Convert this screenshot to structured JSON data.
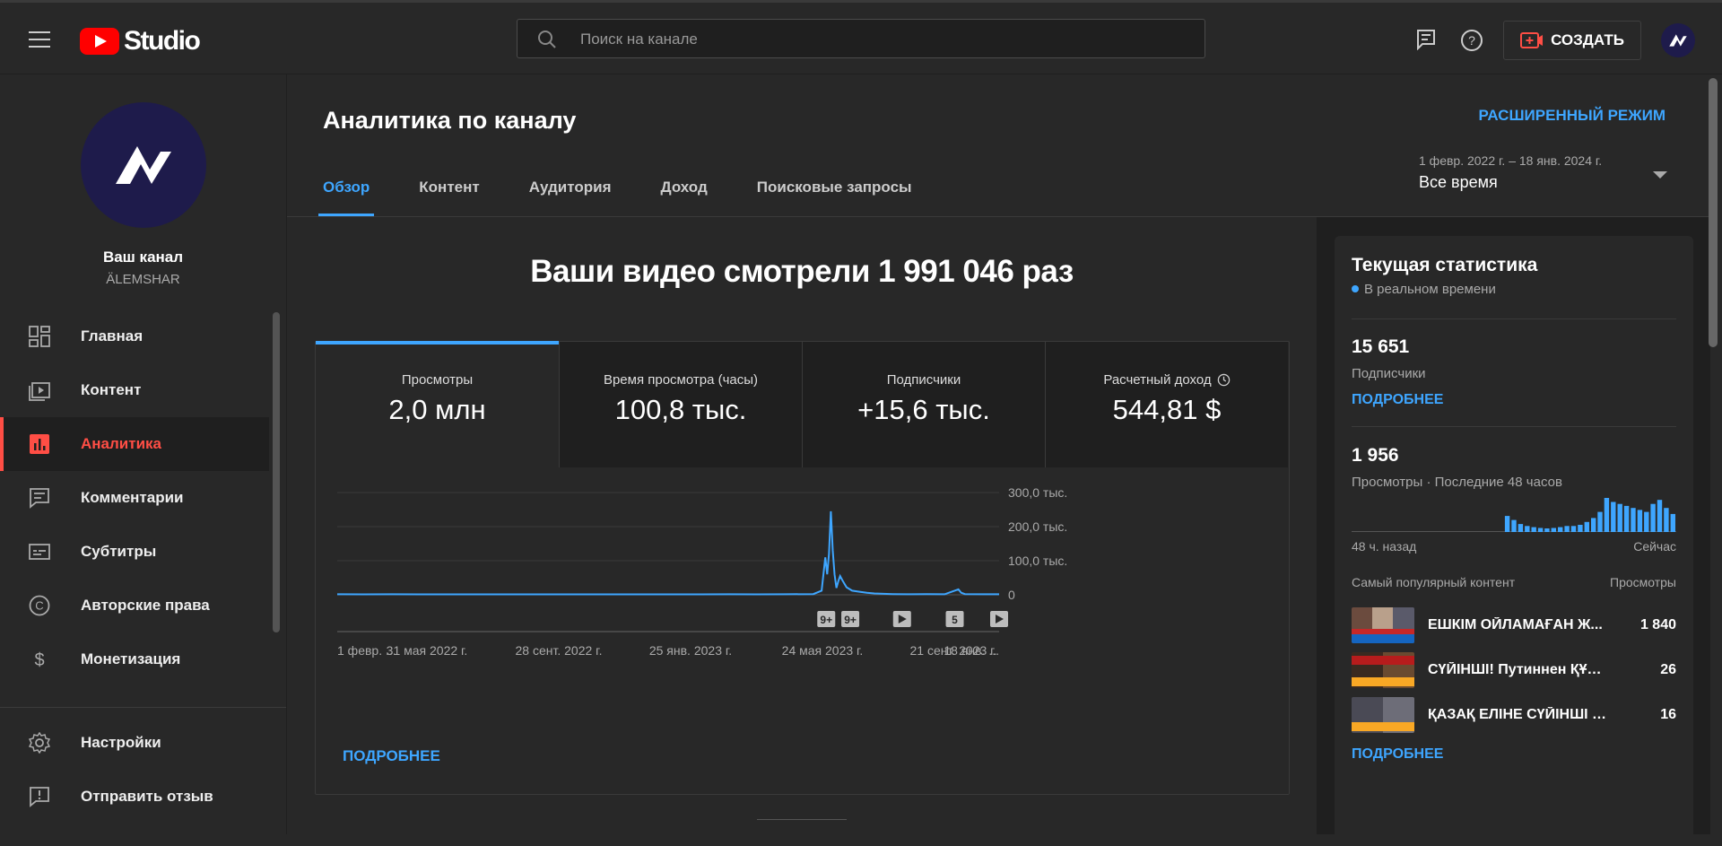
{
  "topbar": {
    "logo_text": "Studio",
    "search_placeholder": "Поиск на канале",
    "create_label": "СОЗДАТЬ"
  },
  "sidebar": {
    "channel_title": "Ваш канал",
    "channel_name": "ÄLEMSHAR",
    "items": [
      {
        "label": "Главная",
        "icon": "dashboard-icon"
      },
      {
        "label": "Контент",
        "icon": "content-icon"
      },
      {
        "label": "Аналитика",
        "icon": "analytics-icon",
        "active": true
      },
      {
        "label": "Комментарии",
        "icon": "comments-icon"
      },
      {
        "label": "Субтитры",
        "icon": "subtitles-icon"
      },
      {
        "label": "Авторские права",
        "icon": "copyright-icon"
      },
      {
        "label": "Монетизация",
        "icon": "dollar-icon"
      }
    ],
    "bottom_items": [
      {
        "label": "Настройки",
        "icon": "gear-icon"
      },
      {
        "label": "Отправить отзыв",
        "icon": "feedback-icon"
      }
    ]
  },
  "main": {
    "title": "Аналитика по каналу",
    "advanced_mode": "РАСШИРЕННЫЙ РЕЖИМ",
    "tabs": [
      {
        "label": "Обзор",
        "active": true
      },
      {
        "label": "Контент"
      },
      {
        "label": "Аудитория"
      },
      {
        "label": "Доход"
      },
      {
        "label": "Поисковые запросы"
      }
    ],
    "date_range": "1 февр. 2022 г. – 18 янв. 2024 г.",
    "date_preset": "Все время",
    "headline": "Ваши видео смотрели 1 991 046 раз",
    "metrics": [
      {
        "label": "Просмотры",
        "value": "2,0 млн",
        "active": true
      },
      {
        "label": "Время просмотра (часы)",
        "value": "100,8 тыс."
      },
      {
        "label": "Подписчики",
        "value": "+15,6 тыс."
      },
      {
        "label": "Расчетный доход",
        "value": "544,81 $"
      }
    ],
    "more_link": "ПОДРОБНЕЕ"
  },
  "chart_data": {
    "type": "line",
    "x_tick_labels": [
      "1 февр. ...",
      "31 мая 2022 г.",
      "28 сент. 2022 г.",
      "25 янв. 2023 г.",
      "24 мая 2023 г.",
      "21 сент. 2023 г.",
      "18 янв. ..."
    ],
    "y_tick_labels": [
      "300,0 тыс.",
      "200,0 тыс.",
      "100,0 тыс.",
      "0"
    ],
    "ylim": [
      0,
      300000
    ],
    "series": [
      {
        "values_description_free": true,
        "points": [
          [
            "2022-02-01",
            1500
          ],
          [
            "2022-03-01",
            1200
          ],
          [
            "2022-04-01",
            1600
          ],
          [
            "2022-05-01",
            1300
          ],
          [
            "2022-06-01",
            1400
          ],
          [
            "2022-07-01",
            1200
          ],
          [
            "2022-08-01",
            1300
          ],
          [
            "2022-09-01",
            1200
          ],
          [
            "2022-10-01",
            1300
          ],
          [
            "2022-11-01",
            1200
          ],
          [
            "2022-12-01",
            1300
          ],
          [
            "2023-01-01",
            1200
          ],
          [
            "2023-02-01",
            1300
          ],
          [
            "2023-03-01",
            1200
          ],
          [
            "2023-04-01",
            1500
          ],
          [
            "2023-05-01",
            1300
          ],
          [
            "2023-06-01",
            1600
          ],
          [
            "2023-07-01",
            2000
          ],
          [
            "2023-07-10",
            12000
          ],
          [
            "2023-07-14",
            110000
          ],
          [
            "2023-07-16",
            60000
          ],
          [
            "2023-07-18",
            120000
          ],
          [
            "2023-07-20",
            245000
          ],
          [
            "2023-07-22",
            130000
          ],
          [
            "2023-07-24",
            60000
          ],
          [
            "2023-07-26",
            20000
          ],
          [
            "2023-07-28",
            40000
          ],
          [
            "2023-07-30",
            55000
          ],
          [
            "2023-08-02",
            40000
          ],
          [
            "2023-08-06",
            22000
          ],
          [
            "2023-08-12",
            12000
          ],
          [
            "2023-08-20",
            9000
          ],
          [
            "2023-08-28",
            6000
          ],
          [
            "2023-09-05",
            4000
          ],
          [
            "2023-09-15",
            3000
          ],
          [
            "2023-09-25",
            2000
          ],
          [
            "2023-10-10",
            1500
          ],
          [
            "2023-11-01",
            1800
          ],
          [
            "2023-11-20",
            1500
          ],
          [
            "2023-12-05",
            16000
          ],
          [
            "2023-12-08",
            6000
          ],
          [
            "2023-12-12",
            2000
          ],
          [
            "2024-01-01",
            1500
          ],
          [
            "2024-01-18",
            1500
          ]
        ]
      }
    ],
    "markers": [
      {
        "date": "2023-07-15",
        "label": "9+"
      },
      {
        "date": "2023-08-10",
        "label": "9+"
      },
      {
        "date": "2023-10-05",
        "label": "play-icon"
      },
      {
        "date": "2023-12-01",
        "label": "5"
      },
      {
        "date": "2024-01-18",
        "label": "play-icon"
      }
    ],
    "x_start": "2022-02-01",
    "x_end": "2024-01-18",
    "color": "#3ea6ff",
    "grid": true
  },
  "realtime": {
    "title": "Текущая статистика",
    "live_label": "В реальном времени",
    "subs_value": "15 651",
    "subs_label": "Подписчики",
    "subs_more": "ПОДРОБНЕЕ",
    "views_value": "1 956",
    "views_label": "Просмотры · Последние 48 часов",
    "spark_start": "48 ч. назад",
    "spark_end": "Сейчас",
    "spark_values": [
      0,
      0,
      0,
      0,
      0,
      0,
      0,
      0,
      0,
      0,
      0,
      0,
      0,
      0,
      0,
      0,
      0,
      0,
      0,
      0,
      0,
      0,
      0,
      0,
      0,
      0,
      0,
      0,
      0,
      0,
      0,
      0,
      0,
      0,
      0,
      0,
      0,
      0,
      0,
      0,
      0,
      0,
      0,
      0,
      0,
      0,
      0,
      0,
      0,
      0,
      0,
      0,
      0,
      0,
      0,
      0,
      0,
      0,
      0,
      0,
      0,
      0,
      0,
      0,
      0,
      0,
      0,
      0,
      0,
      0,
      0,
      0,
      0,
      0,
      0,
      0,
      0,
      0,
      0,
      0,
      0,
      0,
      0,
      0,
      0,
      0,
      0,
      0,
      0,
      0,
      0,
      0,
      0,
      0,
      0,
      0,
      0,
      0,
      0,
      0,
      0,
      0,
      0,
      0,
      0,
      0,
      0,
      0,
      0,
      0,
      0,
      0,
      0,
      0,
      0,
      0,
      0,
      0,
      0,
      0,
      0,
      0,
      0,
      0,
      0,
      0,
      0,
      0,
      0,
      0,
      0,
      0,
      0,
      0,
      0,
      0,
      0,
      0,
      0,
      0,
      0,
      0,
      0,
      0,
      0,
      0,
      0,
      0,
      0,
      0
    ],
    "spark_bars": [
      0,
      0,
      0,
      0,
      0,
      0,
      0,
      0,
      0,
      0,
      0,
      0,
      0,
      0,
      0,
      0,
      0,
      0,
      0,
      0,
      0,
      0,
      0,
      40,
      30,
      20,
      15,
      12,
      10,
      9,
      10,
      12,
      15,
      15,
      18,
      25,
      35,
      50,
      85,
      75,
      70,
      65,
      60,
      55,
      50,
      70,
      80,
      60,
      45
    ],
    "top_header_left": "Самый популярный контент",
    "top_header_right": "Просмотры",
    "top_items": [
      {
        "title": "ЕШКІМ ОЙЛАМАҒАН Ж...",
        "views": "1 840"
      },
      {
        "title": "СҮЙІНШІ! Путиннен ҚҰТЫ...",
        "views": "26"
      },
      {
        "title": "ҚАЗАҚ ЕЛІНЕ СҮЙІНШІ АҚ...",
        "views": "16"
      }
    ],
    "top_more": "ПОДРОБНЕЕ"
  }
}
